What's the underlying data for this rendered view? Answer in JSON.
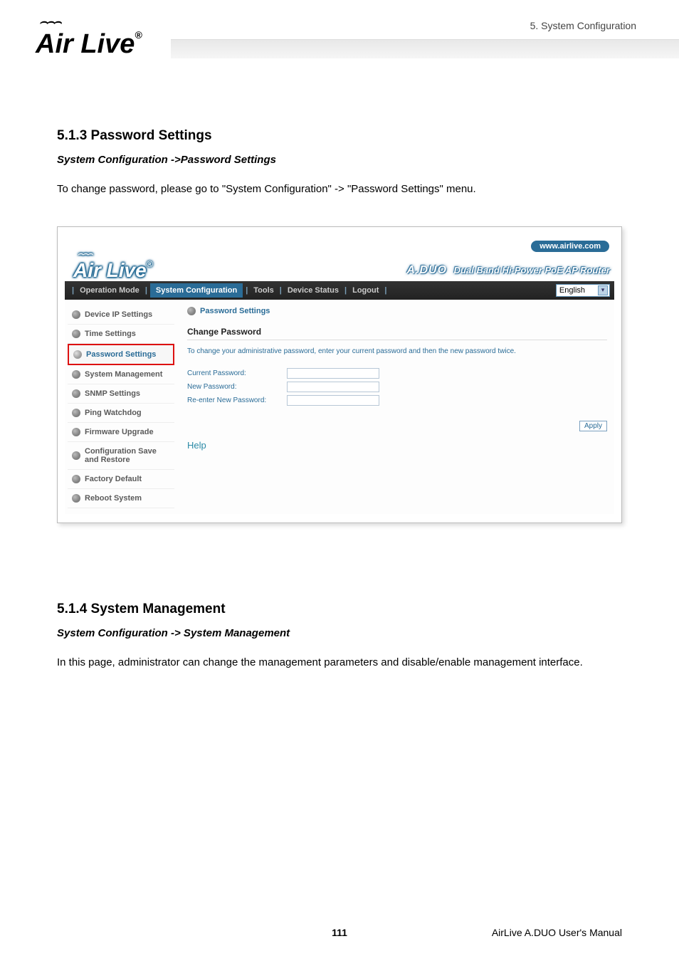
{
  "header": {
    "breadcrumb": "5.  System  Configuration",
    "logo_text": "Air Live",
    "logo_reg": "®"
  },
  "section513": {
    "title": "5.1.3 Password Settings",
    "path": "System Configuration ->Password Settings",
    "body": "To change password, please go to \"System Configuration\" -> \"Password Settings\" menu."
  },
  "shot": {
    "www": "www.airlive.com",
    "product_model": "A.DUO",
    "product_desc": "Dual Band Hi-Power PoE AP Router",
    "nav": {
      "operation_mode": "Operation Mode",
      "system_configuration": "System Configuration",
      "tools": "Tools",
      "device_status": "Device Status",
      "logout": "Logout",
      "language": "English"
    },
    "side": {
      "device_ip": "Device IP Settings",
      "time": "Time Settings",
      "password": "Password Settings",
      "system_management": "System Management",
      "snmp": "SNMP Settings",
      "ping_watchdog": "Ping Watchdog",
      "firmware": "Firmware Upgrade",
      "config_save": "Configuration Save and Restore",
      "factory": "Factory Default",
      "reboot": "Reboot System"
    },
    "main": {
      "crumb": "Password Settings",
      "heading": "Change Password",
      "desc": "To change your administrative password, enter your current password and then the new password twice.",
      "label_current": "Current Password:",
      "label_new": "New Password:",
      "label_re": "Re-enter New Password:",
      "apply": "Apply",
      "help": "Help"
    }
  },
  "section514": {
    "title": "5.1.4 System Management",
    "path": "System Configuration -> System Management",
    "body": "In this page, administrator can change the management parameters and disable/enable management interface."
  },
  "footer": {
    "page": "111",
    "manual": "AirLive A.DUO User's Manual"
  }
}
